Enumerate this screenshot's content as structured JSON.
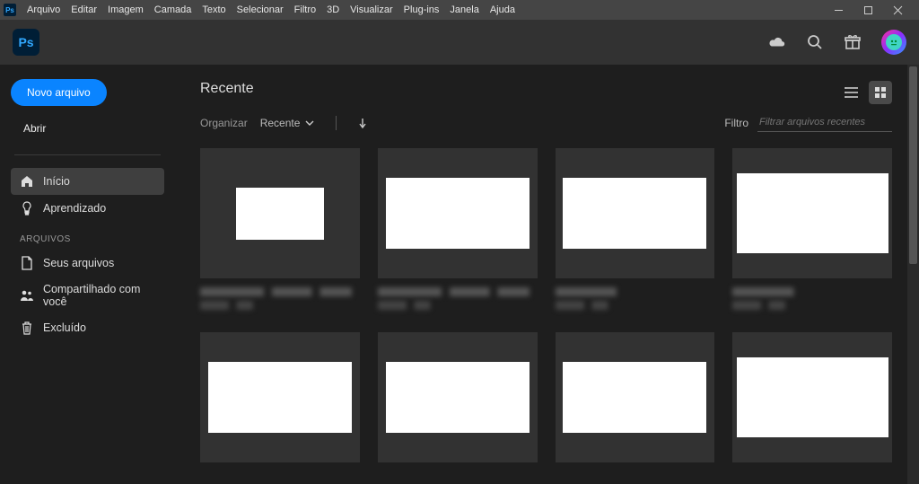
{
  "menu": {
    "items": [
      "Arquivo",
      "Editar",
      "Imagem",
      "Camada",
      "Texto",
      "Selecionar",
      "Filtro",
      "3D",
      "Visualizar",
      "Plug-ins",
      "Janela",
      "Ajuda"
    ]
  },
  "app": {
    "logo_text": "Ps"
  },
  "sidebar": {
    "new_file": "Novo arquivo",
    "open": "Abrir",
    "nav": {
      "home": "Início",
      "learn": "Aprendizado"
    },
    "files_header": "ARQUIVOS",
    "files": {
      "your_files": "Seus arquivos",
      "shared": "Compartilhado com você",
      "deleted": "Excluído"
    }
  },
  "content": {
    "title": "Recente",
    "organize_label": "Organizar",
    "sort_value": "Recente",
    "filter_label": "Filtro",
    "filter_placeholder": "Filtrar arquivos recentes"
  }
}
